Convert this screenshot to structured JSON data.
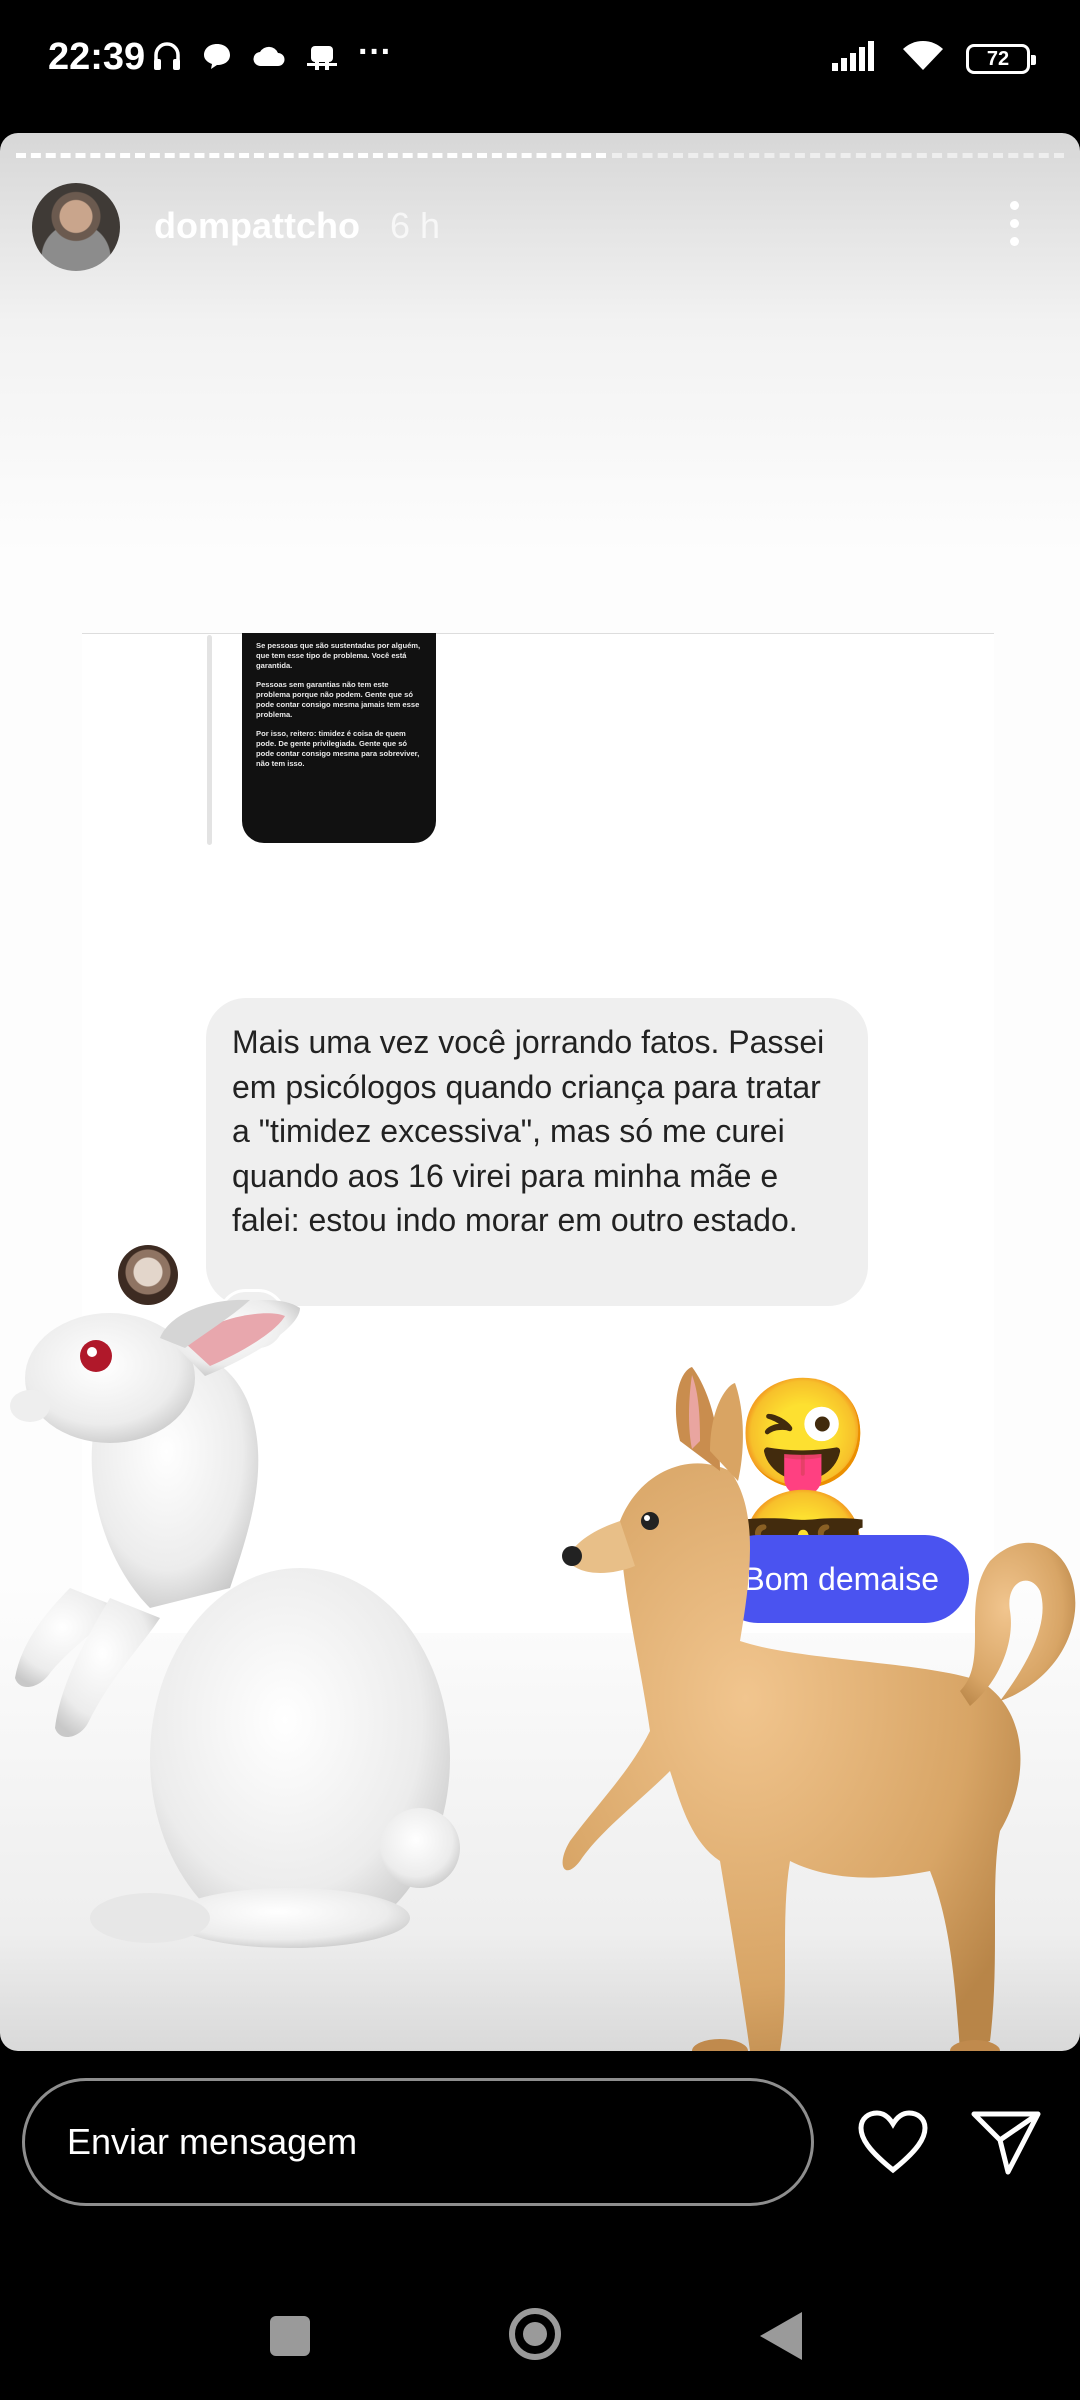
{
  "status_bar": {
    "time": "22:39",
    "more": "···",
    "battery": "72",
    "notification_icons": [
      "headset-icon",
      "chat-bubble-icon",
      "cloud-icon",
      "android-icon"
    ],
    "system_icons": [
      "signal-icon",
      "wifi-icon",
      "battery-icon"
    ]
  },
  "story": {
    "username": "dompattcho",
    "time_ago": "6 h",
    "progress_segments": 2,
    "current_segment": 1
  },
  "conversation": {
    "quoted_story_lines": [
      "Se pessoas que são sustentadas por alguém, que tem esse tipo de problema. Você está garantida.",
      "Pessoas sem garantias não tem este problema porque não podem. Gente que só pode contar consigo mesma jamais tem esse problema.",
      "Por isso, reitero: timidez é coisa de quem pode. De gente privilegiada. Gente que só pode contar consigo mesma para sobreviver, não tem isso."
    ],
    "received_message": "Mais uma vez você jorrando fatos. Passei em psicólogos quando criança para tratar a \"timidez excessiva\", mas só me curei quando aos 16 virei para minha mãe e falei: estou indo morar em outro estado.",
    "reaction": "❤️",
    "sent_emojis": "😜😎",
    "sent_message": "Bom demaise",
    "sent_bubble_color": "#4a53f0"
  },
  "stickers": [
    "rabbit-sticker",
    "dog-sticker"
  ],
  "reply": {
    "placeholder": "Enviar mensagem"
  },
  "nav": [
    "recents-button",
    "home-button",
    "back-button"
  ]
}
